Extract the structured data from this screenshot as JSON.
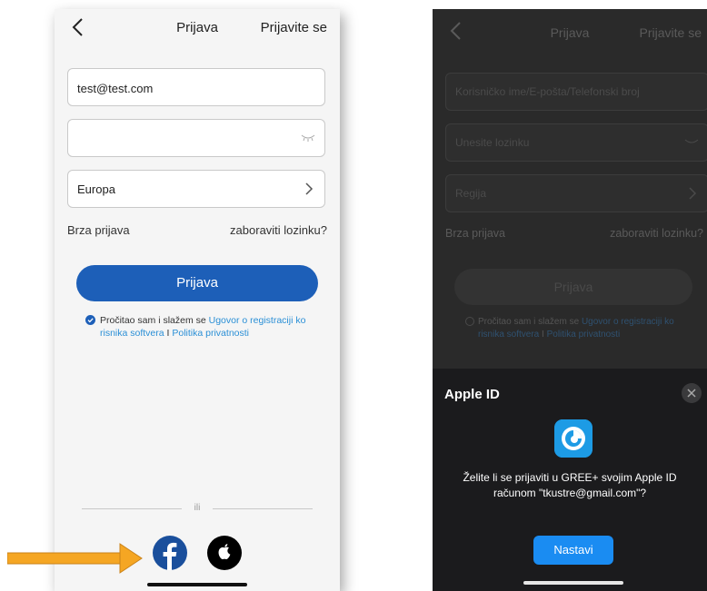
{
  "left_screen": {
    "nav": {
      "title": "Prijava",
      "action": "Prijavite se"
    },
    "email_value": "test@test.com",
    "password_value": "",
    "region_value": "Europa",
    "quick_login": "Brza prijava",
    "forgot_password": "zaboraviti lozinku?",
    "login_button": "Prijava",
    "agreement": {
      "prefix": "Pročitao sam i slažem se ",
      "terms_link": "Ugovor o registraciji ko risnika softvera",
      "separator": " I ",
      "privacy_link": "Politika privatnosti"
    },
    "divider_text": "ili"
  },
  "right_screen": {
    "nav": {
      "title": "Prijava",
      "action": "Prijavite se"
    },
    "username_placeholder": "Korisničko ime/E-pošta/Telefonski broj",
    "password_placeholder": "Unesite lozinku",
    "region_placeholder": "Regija",
    "quick_login": "Brza prijava",
    "forgot_password": "zaboraviti lozinku?",
    "login_button": "Prijava",
    "agreement": {
      "prefix": "Pročitao sam i slažem se ",
      "terms_link": "Ugovor o registraciji ko risnika softvera",
      "separator": " I ",
      "privacy_link": "Politika privatnosti"
    },
    "apple_sheet": {
      "title": "Apple ID",
      "message": "Želite li se prijaviti u GREE+ svojim Apple ID računom \"tkustre@gmail.com\"?",
      "continue_button": "Nastavi"
    }
  },
  "icons": {
    "back": "chevron-left-icon",
    "eye": "eye-closed-icon",
    "chevron": "chevron-right-icon",
    "facebook": "facebook-icon",
    "apple": "apple-icon",
    "close": "close-icon",
    "app": "gree-app-icon",
    "arrow": "orange-arrow-icon"
  },
  "colors": {
    "primary": "#1d5fb8",
    "link": "#2a8fd6",
    "arrow": "#f5a623",
    "continue_button": "#1a8cf2"
  }
}
